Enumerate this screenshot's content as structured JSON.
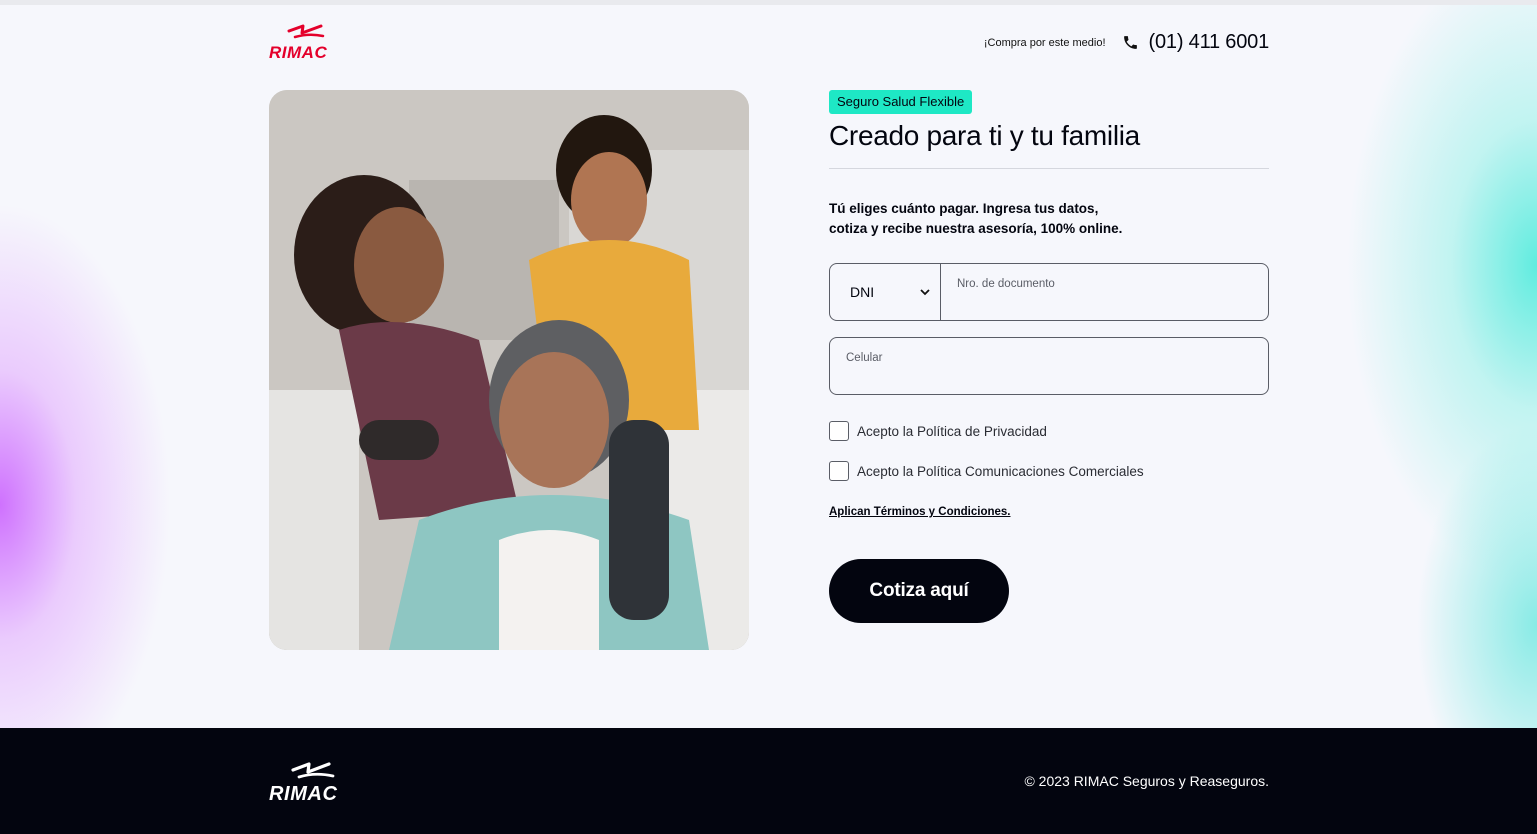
{
  "header": {
    "brand": "RIMAC",
    "contact_text": "¡Compra por este medio!",
    "phone": "(01) 411 6001"
  },
  "hero": {
    "badge": "Seguro Salud Flexible",
    "title": "Creado para ti y tu familia",
    "intro_line1": "Tú eliges cuánto pagar. Ingresa tus datos,",
    "intro_line2": "cotiza y recibe nuestra asesoría, 100% online."
  },
  "form": {
    "doc_type": "DNI",
    "doc_number_label": "Nro. de documento",
    "doc_number_value": "",
    "phone_label": "Celular",
    "phone_value": "",
    "privacy_label": "Acepto la Política de Privacidad",
    "privacy_checked": false,
    "comms_label": "Acepto la Política Comunicaciones Comerciales",
    "comms_checked": false,
    "terms_link": "Aplican Términos y Condiciones.",
    "submit_label": "Cotiza aquí"
  },
  "footer": {
    "brand": "RIMAC",
    "copyright": "© 2023 RIMAC Seguros y Reaseguros."
  },
  "colors": {
    "brand_red": "#e4002b",
    "badge_bg": "#1ee8c5",
    "dark": "#03050f"
  },
  "icons": {
    "phone": "phone-icon",
    "select": "chevron-down-icon"
  }
}
